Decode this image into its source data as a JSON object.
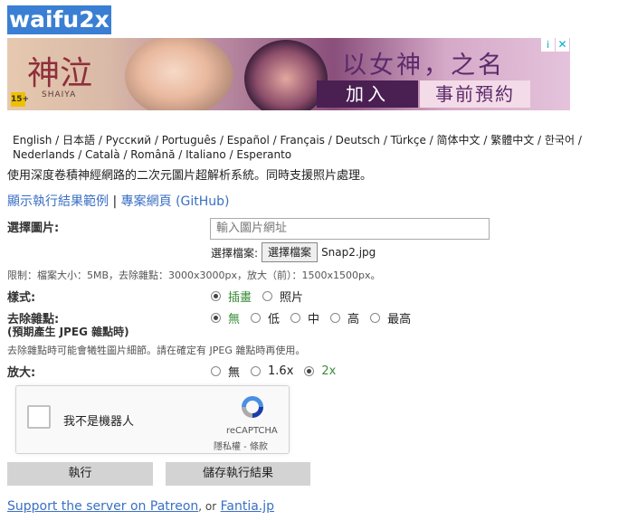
{
  "app": {
    "logo": "waifu2x"
  },
  "ad": {
    "brand": "神泣",
    "brand_sub": "SHAIYA",
    "age_badge": "15+",
    "headline": "以女神，之名",
    "cta_join": "加入",
    "cta_preregister": "事前預約",
    "info_icon": "i",
    "close_icon": "✕"
  },
  "languages": [
    "English",
    "日本語",
    "Русский",
    "Português",
    "Español",
    "Français",
    "Deutsch",
    "Türkçe",
    "简体中文",
    "繁體中文",
    "한국어",
    "Nederlands",
    "Català",
    "Română",
    "Italiano",
    "Esperanto"
  ],
  "description": "使用深度卷積神經網路的二次元圖片超解析系統。同時支援照片處理。",
  "links": {
    "examples": "顯示執行結果範例",
    "separator": "|",
    "project": "專案網頁 (GitHub)"
  },
  "image": {
    "label": "選擇圖片:",
    "url_placeholder": "輸入圖片網址",
    "file_label": "選擇檔案:",
    "file_button": "選擇檔案",
    "file_name": "Snap2.jpg",
    "limits": "限制：檔案大小：5MB，去除雜點：3000x3000px，放大（前）：1500x1500px。"
  },
  "style": {
    "label": "樣式:",
    "options": [
      {
        "label": "插畫",
        "selected": true
      },
      {
        "label": "照片",
        "selected": false
      }
    ]
  },
  "noise": {
    "label": "去除雜點:",
    "sublabel": "(預期產生 JPEG 雜點時)",
    "options": [
      {
        "label": "無",
        "selected": true
      },
      {
        "label": "低",
        "selected": false
      },
      {
        "label": "中",
        "selected": false
      },
      {
        "label": "高",
        "selected": false
      },
      {
        "label": "最高",
        "selected": false
      }
    ],
    "note": "去除雜點時可能會犧牲圖片細節。請在確定有 JPEG 雜點時再使用。"
  },
  "scale": {
    "label": "放大:",
    "options": [
      {
        "label": "無",
        "selected": false
      },
      {
        "label": "1.6x",
        "selected": false
      },
      {
        "label": "2x",
        "selected": true
      }
    ]
  },
  "captcha": {
    "checkbox_label": "我不是機器人",
    "brand": "reCAPTCHA",
    "terms": "隱私權 - 條款"
  },
  "buttons": {
    "run": "執行",
    "save": "儲存執行結果"
  },
  "footer": {
    "patreon": "Support the server on Patreon",
    "or": ", or",
    "fantia": "Fantia.jp"
  },
  "colors": {
    "logo_bg": "#3a7fd3",
    "link": "#3a6fc4",
    "selected_option": "#3a8f3a"
  }
}
